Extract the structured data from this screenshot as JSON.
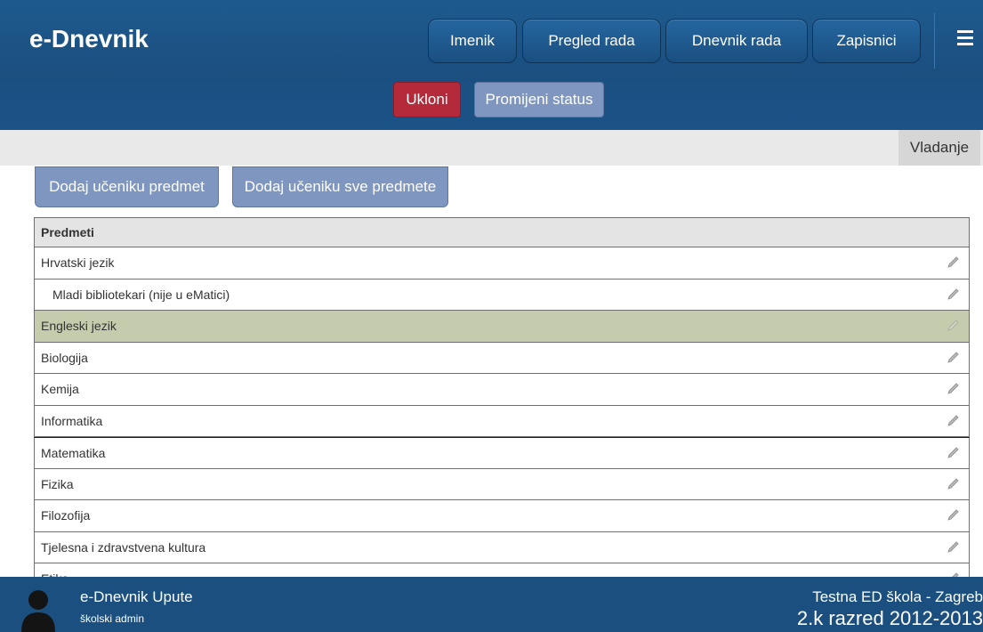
{
  "header": {
    "brand": "e-Dnevnik",
    "nav": [
      "Imenik",
      "Pregled rada",
      "Dnevnik rada",
      "Zapisnici"
    ],
    "menu_icon": "hamburger-icon"
  },
  "actions": {
    "remove": "Ukloni",
    "change_status": "Promijeni status",
    "remove_color": "#b52a3a",
    "status_color": "#7e96c0"
  },
  "tabs": {
    "vladanje": "Vladanje"
  },
  "buttons": {
    "add_subject": "Dodaj učeniku predmet",
    "add_all": "Dodaj učeniku sve predmete"
  },
  "table": {
    "header": "Predmeti",
    "rows": [
      "Hrvatski jezik",
      "Mladi bibliotekari (nije u eMatici)",
      "Engleski jezik",
      "Biologija",
      "Kemija",
      "Informatika",
      "Matematika",
      "Fizika",
      "Filozofija",
      "Tjelesna i zdravstvena kultura",
      "Etika"
    ],
    "selected_color": "#c4ccad",
    "row_icon": "pencil-icon"
  },
  "footer": {
    "title": "e-Dnevnik Upute",
    "role": "školski admin",
    "school": "Testna ED škola - Zagreb",
    "class": "2.k razred 2012-2013",
    "avatar_icon": "user-silhouette-icon"
  }
}
